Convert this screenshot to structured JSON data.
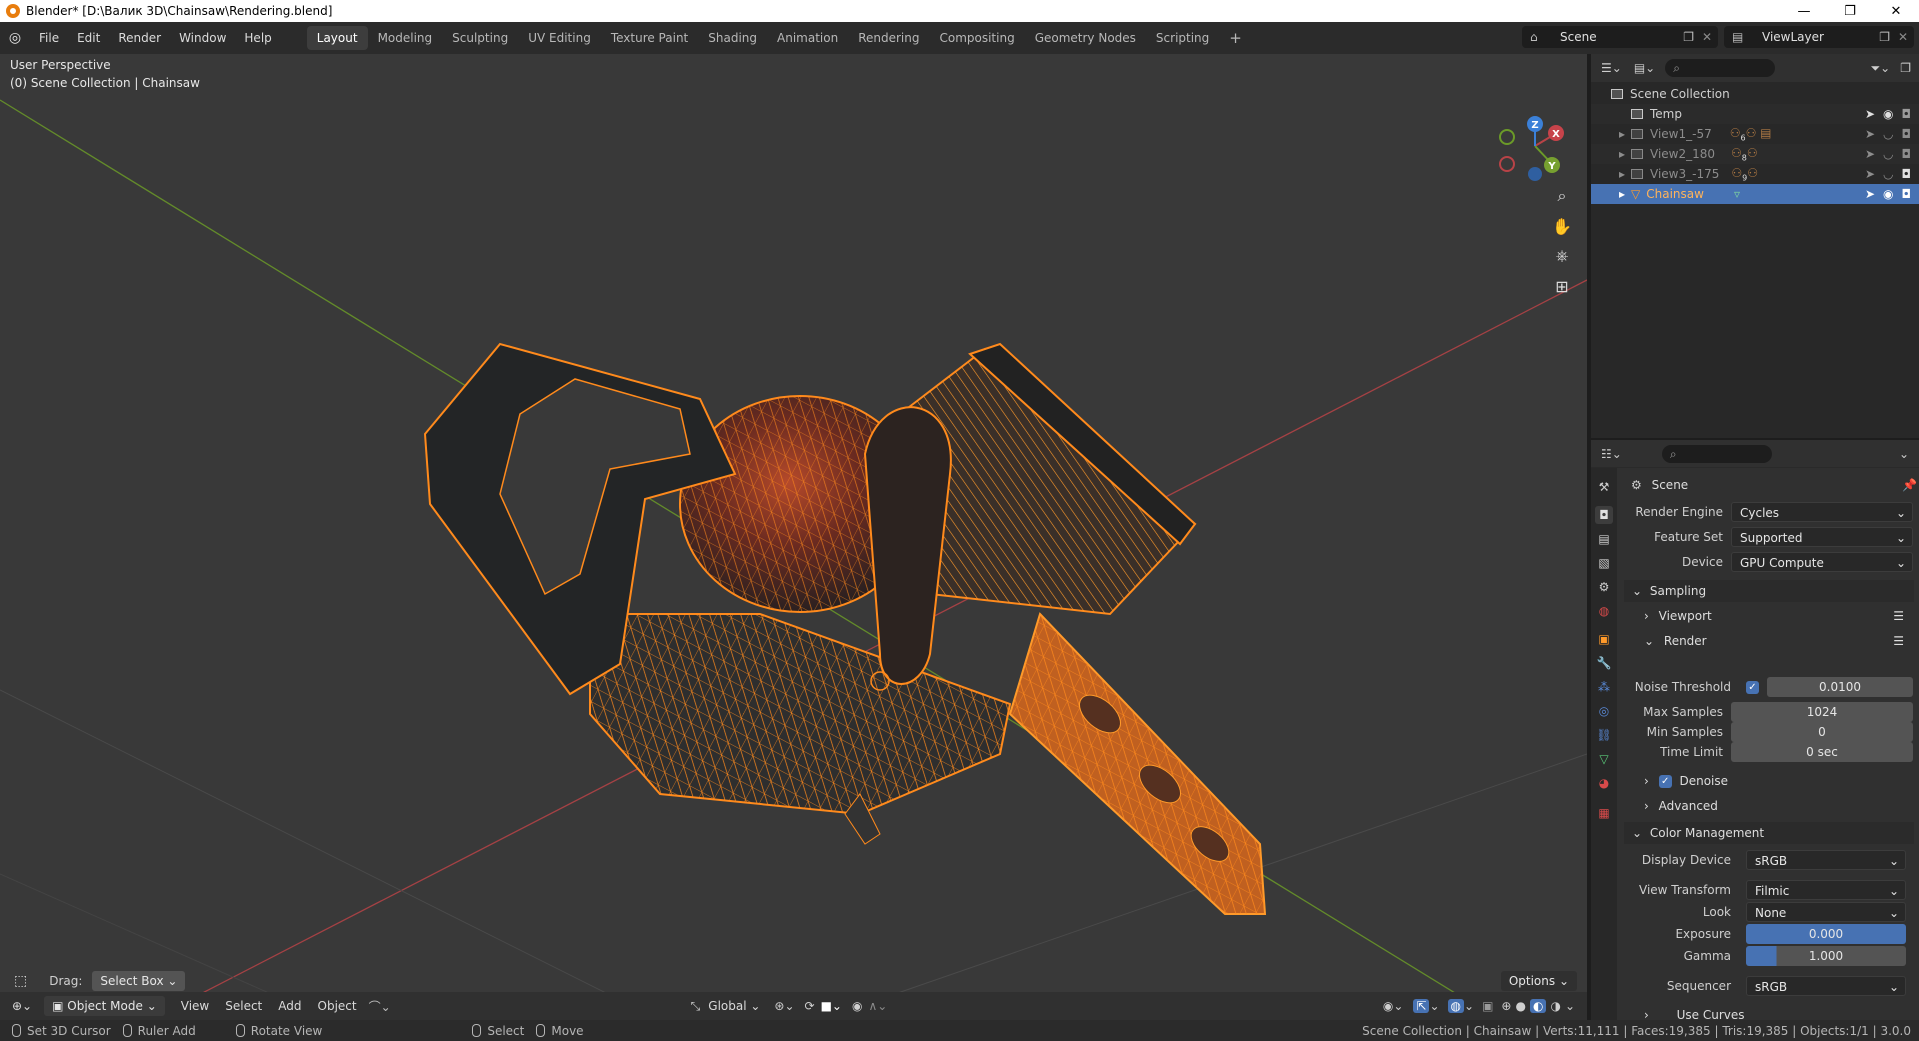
{
  "window": {
    "title": "Blender* [D:\\Валик 3D\\Chainsaw\\Rendering.blend]",
    "controls": [
      "—",
      "❐",
      "✕"
    ]
  },
  "menubar": {
    "items": [
      "File",
      "Edit",
      "Render",
      "Window",
      "Help"
    ],
    "workspaces": [
      "Layout",
      "Modeling",
      "Sculpting",
      "UV Editing",
      "Texture Paint",
      "Shading",
      "Animation",
      "Rendering",
      "Compositing",
      "Geometry Nodes",
      "Scripting"
    ],
    "active_workspace": "Layout",
    "add_tab": "+",
    "scene": "Scene",
    "view_layer": "ViewLayer"
  },
  "viewport": {
    "perspective": "User Perspective",
    "collection_info": "(0) Scene Collection | Chainsaw",
    "gizmo_axes": [
      "X",
      "Y",
      "Z"
    ],
    "drag_label": "Drag:",
    "drag_value": "Select Box",
    "options_label": "Options",
    "mode": "Object Mode",
    "menus": [
      "View",
      "Select",
      "Add",
      "Object"
    ],
    "orientation": "Global"
  },
  "outliner": {
    "root": "Scene Collection",
    "items": [
      {
        "name": "Temp",
        "state": "visible"
      },
      {
        "name": "View1_-57",
        "state": "hidden",
        "badge": "6"
      },
      {
        "name": "View2_180",
        "state": "hidden",
        "badge": "8"
      },
      {
        "name": "View3_-175",
        "state": "hidden",
        "badge": "9"
      },
      {
        "name": "Chainsaw",
        "state": "selected"
      }
    ]
  },
  "properties": {
    "context": "Scene",
    "render_engine_label": "Render Engine",
    "render_engine": "Cycles",
    "feature_set_label": "Feature Set",
    "feature_set": "Supported",
    "device_label": "Device",
    "device": "GPU Compute",
    "sampling": "Sampling",
    "viewport": "Viewport",
    "render": "Render",
    "noise_threshold_label": "Noise Threshold",
    "noise_threshold": "0.0100",
    "max_samples_label": "Max Samples",
    "max_samples": "1024",
    "min_samples_label": "Min Samples",
    "min_samples": "0",
    "time_limit_label": "Time Limit",
    "time_limit": "0 sec",
    "denoise": "Denoise",
    "advanced": "Advanced",
    "color_management": "Color Management",
    "display_device_label": "Display Device",
    "display_device": "sRGB",
    "view_transform_label": "View Transform",
    "view_transform": "Filmic",
    "look_label": "Look",
    "look": "None",
    "exposure_label": "Exposure",
    "exposure": "0.000",
    "gamma_label": "Gamma",
    "gamma": "1.000",
    "sequencer_label": "Sequencer",
    "sequencer": "sRGB",
    "use_curves": "Use Curves"
  },
  "statusbar": {
    "hints": [
      "Set 3D Cursor",
      "Ruler Add",
      "Rotate View",
      "Select",
      "Move"
    ],
    "stats": "Scene Collection | Chainsaw | Verts:11,111 | Faces:19,385 | Tris:19,385 | Objects:1/1 | 3.0.0"
  },
  "colors": {
    "accent": "#4772b3",
    "selection_orange": "#ff8a1c",
    "x_axis": "#b84347",
    "y_axis": "#6b9a28",
    "z_axis": "#3b80d8",
    "viewport_bg": "#393939"
  }
}
